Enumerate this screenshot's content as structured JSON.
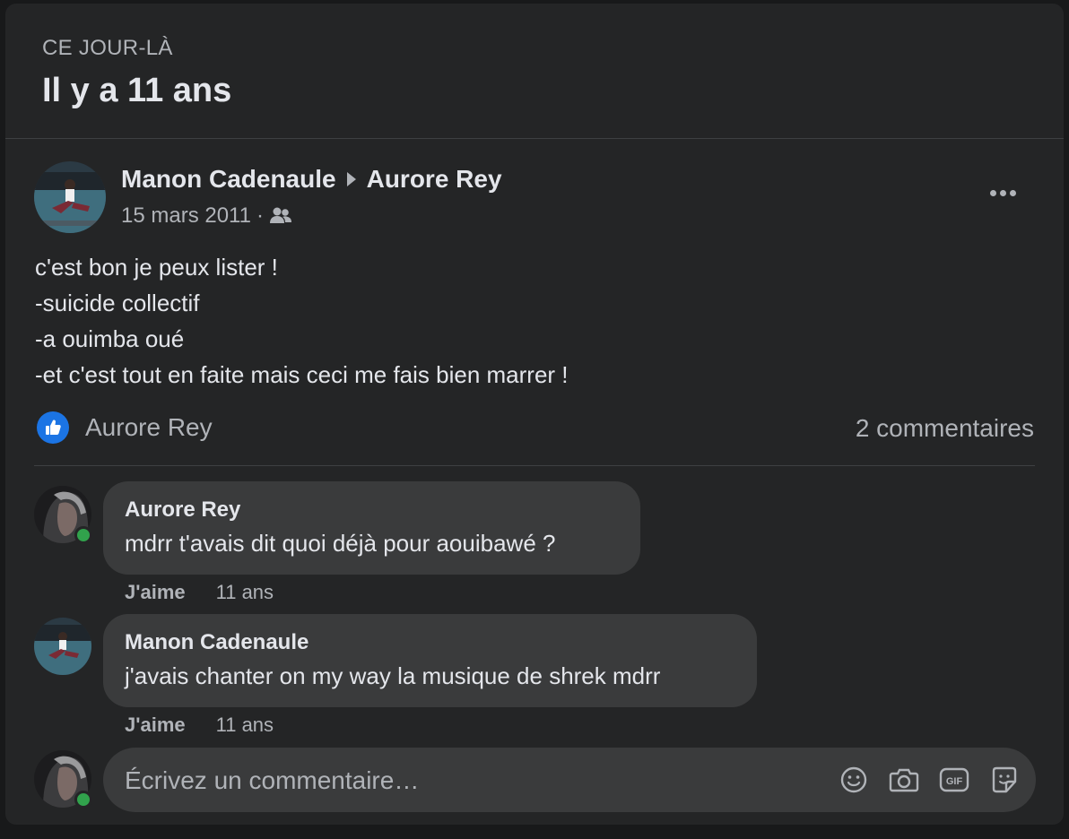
{
  "header": {
    "kicker": "CE JOUR-LÀ",
    "title": "Il y a 11 ans"
  },
  "post": {
    "author": "Manon Cadenaule",
    "target": "Aurore Rey",
    "date": "15 mars 2011",
    "separator": "·",
    "audience_icon": "friends-icon",
    "body_lines": [
      "c'est bon je peux lister !",
      "-suicide collectif",
      "-a ouimba oué",
      "-et c'est tout en faite mais ceci me fais bien marrer !"
    ],
    "reaction_icon": "like-icon",
    "reaction_names": "Aurore Rey",
    "comments_count": "2 commentaires"
  },
  "comments": [
    {
      "author": "Aurore Rey",
      "text": "mdrr t'avais dit quoi déjà pour aouibawé ?",
      "like_label": "J'aime",
      "time": "11 ans"
    },
    {
      "author": "Manon Cadenaule",
      "text": "j'avais chanter on my way la musique de shrek mdrr",
      "like_label": "J'aime",
      "time": "11 ans"
    }
  ],
  "composer": {
    "placeholder": "Écrivez un commentaire…",
    "icons": [
      "emoji-icon",
      "camera-icon",
      "gif-icon",
      "sticker-icon"
    ]
  },
  "colors": {
    "background": "#18191a",
    "card": "#242526",
    "bubble": "#3a3b3c",
    "primary_text": "#e4e6eb",
    "secondary_text": "#b0b3b8",
    "like_blue": "#1b74e4",
    "online_green": "#31a24c"
  }
}
